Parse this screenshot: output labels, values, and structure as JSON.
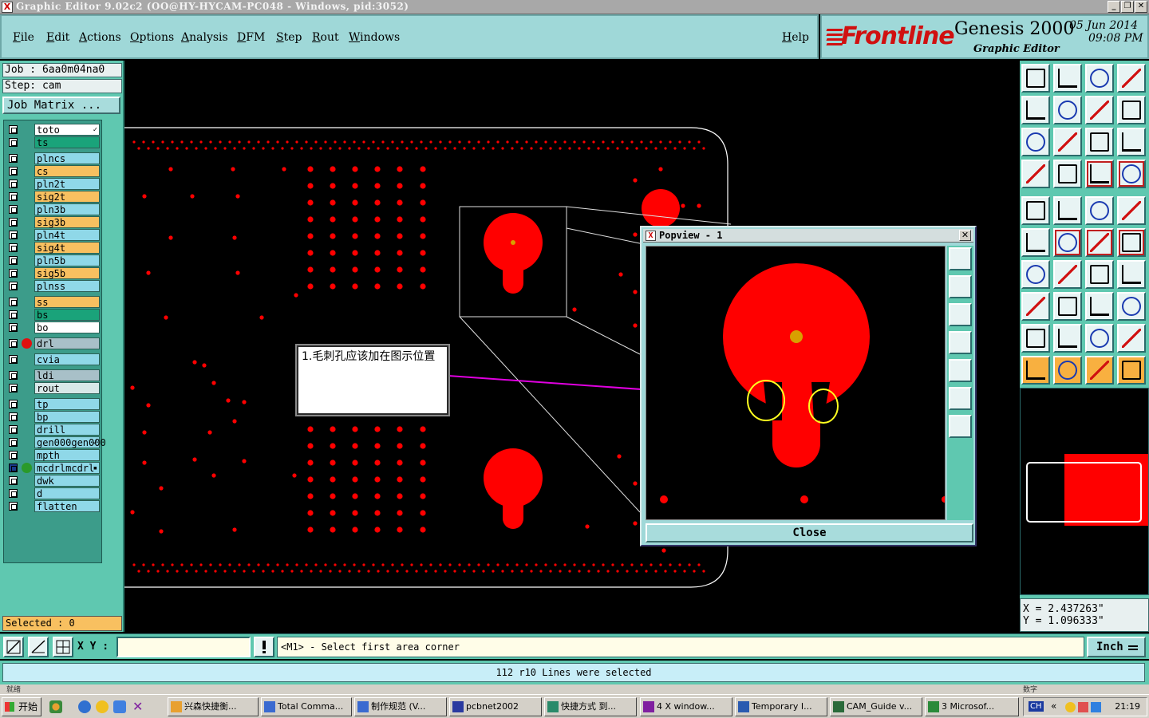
{
  "window": {
    "title": "Graphic Editor 9.02c2 (OO@HY-HYCAM-PC048 - Windows, pid:3052)"
  },
  "menu": {
    "items": [
      "File",
      "Edit",
      "Actions",
      "Options",
      "Analysis",
      "DFM",
      "Step",
      "Rout",
      "Windows"
    ],
    "help": "Help"
  },
  "brand": {
    "logo": "Frontline",
    "product": "Genesis 2000",
    "subtitle": "Graphic Editor",
    "date": "05 Jun 2014",
    "time": "09:08 PM"
  },
  "left": {
    "job": "Job : 6aa0m04na0",
    "step": "Step: cam",
    "job_matrix": "Job Matrix ...",
    "selected": "Selected : 0",
    "layers": [
      {
        "name": "to",
        "color": "#ffffff",
        "mark": "✓"
      },
      {
        "name": "ts",
        "color": "#1aa37a"
      },
      {
        "name": "plncs",
        "color": "#8fd8e8"
      },
      {
        "name": "cs",
        "color": "#f8c060"
      },
      {
        "name": "pln2t",
        "color": "#8fd8e8"
      },
      {
        "name": "sig2t",
        "color": "#f8c060"
      },
      {
        "name": "pln3b",
        "color": "#8fd8e8"
      },
      {
        "name": "sig3b",
        "color": "#f8c060"
      },
      {
        "name": "pln4t",
        "color": "#8fd8e8"
      },
      {
        "name": "sig4t",
        "color": "#f8c060"
      },
      {
        "name": "pln5b",
        "color": "#8fd8e8"
      },
      {
        "name": "sig5b",
        "color": "#f8c060"
      },
      {
        "name": "plnss",
        "color": "#8fd8e8"
      },
      {
        "name": "ss",
        "color": "#f8c060"
      },
      {
        "name": "bs",
        "color": "#1aa37a"
      },
      {
        "name": "bo",
        "color": "#ffffff"
      },
      {
        "name": "drl",
        "color": "#a8c0c8",
        "dot": "#e01010"
      },
      {
        "name": "cvia",
        "color": "#8fd8e8"
      },
      {
        "name": "ldi",
        "color": "#a8c0c8"
      },
      {
        "name": "rout",
        "color": "#d8e8e8"
      },
      {
        "name": "tp",
        "color": "#8fd8e8"
      },
      {
        "name": "bp",
        "color": "#8fd8e8"
      },
      {
        "name": "drill",
        "color": "#8fd8e8"
      },
      {
        "name": "gen000",
        "color": "#8fd8e8",
        "mark": "✓"
      },
      {
        "name": "mpth",
        "color": "#8fd8e8"
      },
      {
        "name": "mcdrl",
        "color": "#8fd8e8",
        "dot": "#2a9a2a",
        "mark": "▪",
        "active": true
      },
      {
        "name": "dwk",
        "color": "#8fd8e8"
      },
      {
        "name": "d",
        "color": "#8fd8e8"
      },
      {
        "name": "flatten",
        "color": "#8fd8e8"
      }
    ]
  },
  "popview": {
    "title": "Popview - 1",
    "close": "Close"
  },
  "annotation": {
    "text": "1.毛刺孔应该加在图示位置"
  },
  "coords": {
    "x": "X = 2.437263\"",
    "y": "Y = 1.096333\""
  },
  "command": {
    "xy_label": "X Y :",
    "xy_value": "",
    "prompt": "<M1> - Select first area corner",
    "unit": "Inch"
  },
  "status": {
    "message": "112 r10 Lines were selected",
    "thin_left": "就绪",
    "thin_right": "数字"
  },
  "taskbar": {
    "start": "开始",
    "tasks": [
      "兴森快捷衡...",
      "Total Comma...",
      "制作规范 (V...",
      "pcbnet2002",
      "快捷方式 到...",
      "4 X window...",
      "Temporary I...",
      "CAM_Guide v...",
      "3 Microsof..."
    ],
    "tray_lang": "CH",
    "clock": "21:19"
  },
  "colors": {
    "pad_red": "#ff0000",
    "panel_teal": "#5fc8b0",
    "menu_cyan": "#9fd8d8",
    "highlight_yellow": "#ffff20",
    "arrow_magenta": "#e000e0"
  }
}
